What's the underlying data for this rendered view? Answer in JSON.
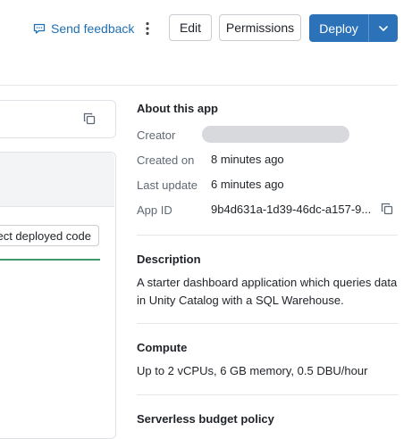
{
  "header": {
    "feedback_label": "Send feedback",
    "edit_label": "Edit",
    "permissions_label": "Permissions",
    "deploy_label": "Deploy"
  },
  "left": {
    "code_button_label": "ect deployed code"
  },
  "about": {
    "title": "About this app",
    "creator_label": "Creator",
    "created_on_label": "Created on",
    "created_on_value": "8 minutes ago",
    "last_update_label": "Last update",
    "last_update_value": "6 minutes ago",
    "app_id_label": "App ID",
    "app_id_value": "9b4d631a-1d39-46dc-a157-9..."
  },
  "description": {
    "title": "Description",
    "text": "A starter dashboard application which queries data in Unity Catalog with a SQL Warehouse."
  },
  "compute": {
    "title": "Compute",
    "text": "Up to 2 vCPUs, 6 GB memory, 0.5 DBU/hour"
  },
  "budget": {
    "title": "Serverless budget policy"
  },
  "colors": {
    "accent": "#2b72b9",
    "link": "#1f6fb2",
    "success": "#3f9a6b"
  },
  "icons": [
    "chat-icon",
    "kebab-icon",
    "chevron-down-icon",
    "copy-icon"
  ]
}
